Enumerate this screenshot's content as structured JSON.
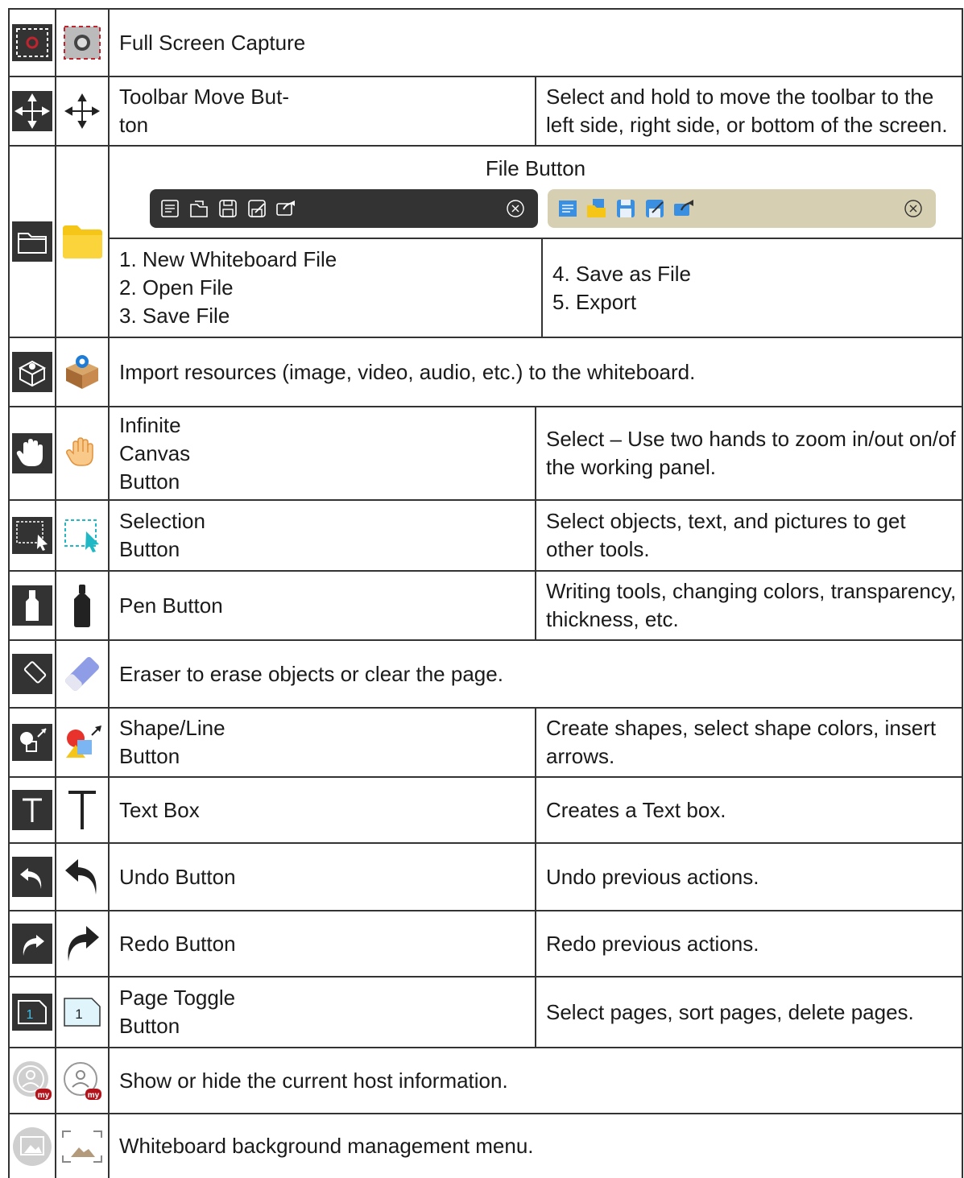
{
  "rows": [
    {
      "name": "Full Screen Capture",
      "icon_a": "screen-capture-dark-icon",
      "icon_b": "screen-capture-color-icon"
    },
    {
      "name": "Toolbar Move But-\nton",
      "desc": "Select and hold to move the toolbar to the left side, right side, or bottom of the screen.",
      "icon_a": "move-arrows-dark-icon",
      "icon_b": "move-arrows-icon"
    },
    {
      "icon_a": "folder-outline-icon",
      "icon_b": "folder-yellow-icon"
    },
    {
      "desc": "Import resources (image, video, audio, etc.) to the whiteboard.",
      "icon_a": "import-box-dark-icon",
      "icon_b": "import-box-color-icon"
    },
    {
      "name": "Infinite\nCanvas\nButton",
      "desc": "Select – Use two hands to zoom in/out on/of the working panel.",
      "icon_a": "hand-dark-icon",
      "icon_b": "hand-color-icon"
    },
    {
      "name": "Selection\nButton",
      "desc": "Select objects, text, and pictures to get other tools.",
      "icon_a": "selection-dark-icon",
      "icon_b": "selection-color-icon"
    },
    {
      "name": "Pen Button",
      "desc": "Writing tools, changing colors, transparency, thickness, etc.",
      "icon_a": "pen-dark-icon",
      "icon_b": "pen-icon"
    },
    {
      "desc": "Eraser to erase objects or clear the page.",
      "icon_a": "eraser-dark-icon",
      "icon_b": "eraser-color-icon"
    },
    {
      "name": "Shape/Line\nButton",
      "desc": "Create shapes, select shape colors, insert arrows.",
      "icon_a": "shape-dark-icon",
      "icon_b": "shape-color-icon"
    },
    {
      "name": "Text Box",
      "desc": "Creates a Text box.",
      "icon_a": "text-dark-icon",
      "icon_b": "text-icon"
    },
    {
      "name": "Undo Button",
      "desc": "Undo previous actions.",
      "icon_a": "undo-dark-icon",
      "icon_b": "undo-icon"
    },
    {
      "name": "Redo Button",
      "desc": "Redo previous actions.",
      "icon_a": "redo-dark-icon",
      "icon_b": "redo-icon"
    },
    {
      "name": "Page Toggle\nButton",
      "desc": "Select pages, sort pages, delete pages.",
      "icon_a": "page-dark-icon",
      "icon_b": "page-color-icon"
    },
    {
      "desc": "Show or hide the current host information.",
      "icon_a": "host-info-dark-icon",
      "icon_b": "host-info-icon"
    },
    {
      "desc": "Whiteboard background management menu.",
      "icon_a": "background-dark-icon",
      "icon_b": "background-icon"
    }
  ],
  "file": {
    "title": "File Button",
    "list_left": [
      "1. New Whiteboard File",
      "2. Open File",
      "3. Save File"
    ],
    "list_right": [
      "4. Save as File",
      "5. Export"
    ],
    "toolbar_icons": [
      "new-file-icon",
      "open-file-icon",
      "save-icon",
      "save-as-icon",
      "export-icon",
      "close-icon"
    ]
  },
  "page_number": "1",
  "host_badge": "my",
  "colors": {
    "border": "#333333",
    "dark_icon_bg": "#333333",
    "toolbar_light": "#d6cfb2",
    "folder": "#f5c518",
    "capture_red": "#c0242e"
  }
}
